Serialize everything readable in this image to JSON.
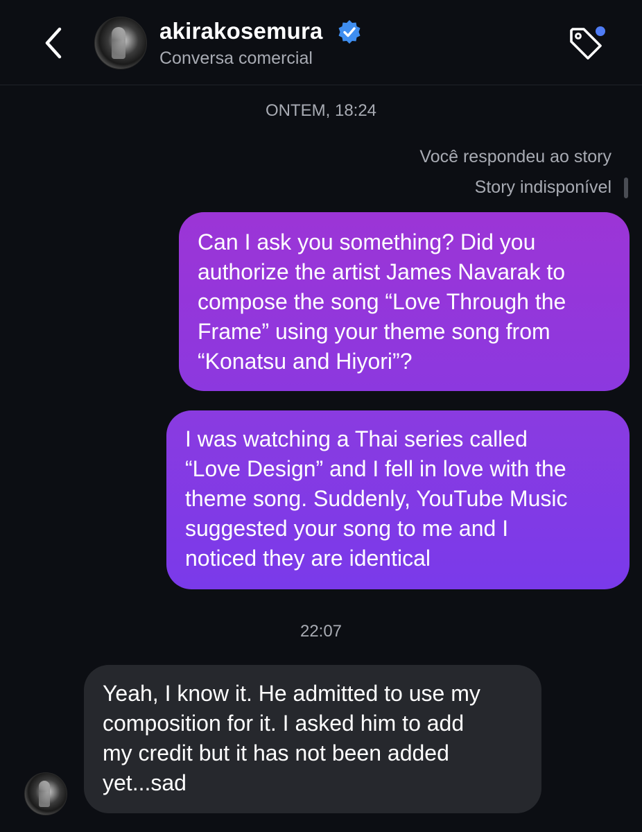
{
  "header": {
    "username": "akirakosemura",
    "subtitle": "Conversa comercial",
    "back_icon": "chevron-left-icon",
    "verified_icon": "verified-badge-icon",
    "tag_icon": "tag-icon",
    "notification_dot_color": "#4f7cf5",
    "verified_color": "#3f8ef0"
  },
  "thread": {
    "timestamp_1": "ONTEM, 18:24",
    "story_reply_label": "Você respondeu ao story",
    "story_unavailable": "Story indisponível",
    "timestamp_2": "22:07",
    "messages": [
      {
        "sender": "me",
        "lines": [
          "Can I ask you something? Did you",
          "authorize the artist James Navarak to",
          "compose the song “Love Through the",
          "Frame” using your theme song from",
          "“Konatsu and Hiyori”?"
        ]
      },
      {
        "sender": "me",
        "lines": [
          "I was watching a Thai series called",
          "“Love Design” and I fell in love with the",
          "theme song. Suddenly, YouTube Music",
          "suggested your song to me and I",
          "noticed they are identical"
        ]
      },
      {
        "sender": "akirakosemura",
        "lines": [
          "Yeah, I know it. He admitted to use my",
          "composition for it. I asked him to add",
          "my credit but it has not been added",
          "yet...sad"
        ]
      }
    ]
  },
  "colors": {
    "background": "#0c0e13",
    "outgoing_bubble_top": "#9c35d6",
    "outgoing_bubble_bottom": "#7a3aea",
    "incoming_bubble": "#26282d",
    "muted_text": "#a8abb3"
  }
}
